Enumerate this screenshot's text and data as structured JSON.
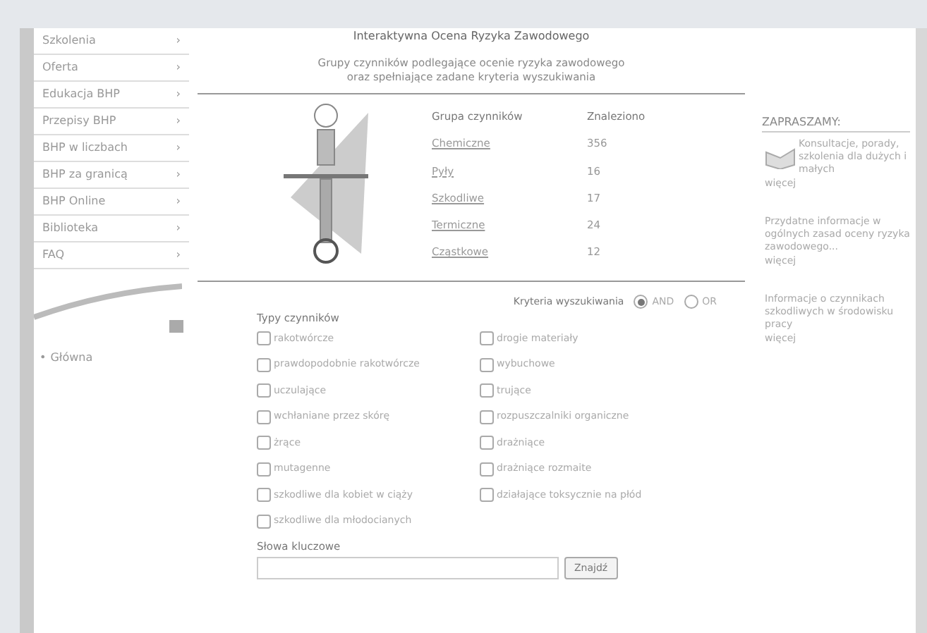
{
  "menu": [
    {
      "label": "Szkolenia"
    },
    {
      "label": "Oferta"
    },
    {
      "label": "Edukacja BHP"
    },
    {
      "label": "Przepisy BHP"
    },
    {
      "label": "BHP w liczbach"
    },
    {
      "label": "BHP za granicą"
    },
    {
      "label": "BHP Online"
    },
    {
      "label": "Biblioteka"
    },
    {
      "label": "FAQ"
    }
  ],
  "arrow": "›",
  "home_bullet": "•",
  "home_link": "Główna",
  "title": "Interaktywna Ocena Ryzyka Zawodowego",
  "subtitle": [
    "Grupy czynników podlegające ocenie ryzyka zawodowego",
    "oraz spełniające zadane kryteria wyszukiwania"
  ],
  "results": {
    "columns": [
      "Grupa czynników",
      "Znaleziono"
    ],
    "rows": [
      {
        "group": "Chemiczne",
        "count": "356"
      },
      {
        "group": "Pyły",
        "count": "16"
      },
      {
        "group": "Szkodliwe",
        "count": "17"
      },
      {
        "group": "Termiczne",
        "count": "24"
      },
      {
        "group": "Cząstkowe",
        "count": "12"
      }
    ]
  },
  "criteria": {
    "label": "Kryteria wyszukiwania",
    "options": [
      {
        "label": "AND",
        "selected": true
      },
      {
        "label": "OR",
        "selected": false
      }
    ]
  },
  "types_label": "Typy czynników",
  "types": [
    {
      "label": "rakotwórcze",
      "checked": false
    },
    {
      "label": "drogie materiały",
      "checked": false
    },
    {
      "label": "prawdopodobnie rakotwórcze",
      "checked": false
    },
    {
      "label": "wybuchowe",
      "checked": false
    },
    {
      "label": "uczulające",
      "checked": false
    },
    {
      "label": "trujące",
      "checked": false
    },
    {
      "label": "wchłaniane przez skórę",
      "checked": false
    },
    {
      "label": "rozpuszczalniki organiczne",
      "checked": false
    },
    {
      "label": "żrące",
      "checked": false
    },
    {
      "label": "drażniące",
      "checked": false
    },
    {
      "label": "mutagenne",
      "checked": false
    },
    {
      "label": "drażniące rozmaite",
      "checked": false
    },
    {
      "label": "szkodliwe dla kobiet w ciąży",
      "checked": false
    },
    {
      "label": "działające toksycznie na płód",
      "checked": false
    },
    {
      "label": "szkodliwe dla młodocianych",
      "checked": false
    }
  ],
  "keywords": {
    "label": "Słowa kluczowe",
    "button": "Znajdź"
  },
  "aside": {
    "title": "ZAPRASZAMY:",
    "items": [
      {
        "text": "Konsultacje, porady, szkolenia dla dużych i małych",
        "more": "więcej",
        "icon": true
      },
      {
        "text": "Przydatne informacje w ogólnych zasad oceny ryzyka zawodowego...",
        "more": "więcej",
        "icon": false
      },
      {
        "text": "Informacje o czynnikach szkodliwych w środowisku pracy",
        "more": "więcej",
        "icon": false
      }
    ]
  }
}
